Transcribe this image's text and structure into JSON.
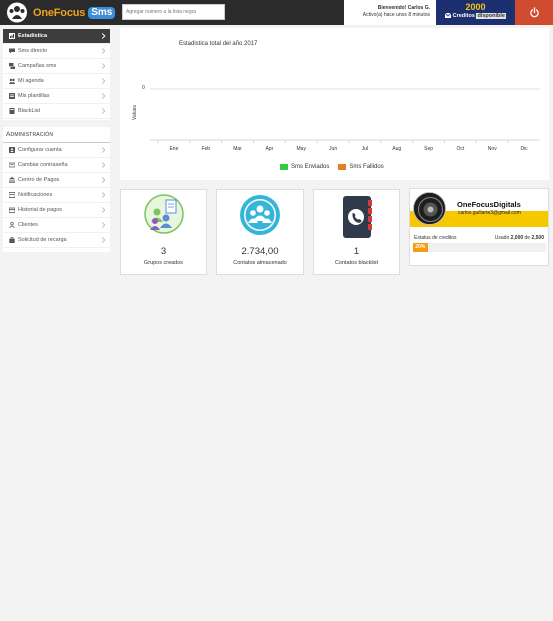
{
  "header": {
    "brand": "OneFocus",
    "brand_sms": "Sms",
    "search_placeholder": "Agregar numero a la lista negra",
    "welcome_line1": "Bienvenido! Carlos G.",
    "welcome_line2": "Activo(a) hace unos 8 minutos",
    "credits_value": "2000",
    "credits_label_1": "Creditos",
    "credits_label_2": "disponible",
    "accent_credits": "#1c2f6e",
    "accent_power": "#d14b2e"
  },
  "sidebar": {
    "items": [
      {
        "label": "Estadística",
        "icon": "chart-icon",
        "active": true
      },
      {
        "label": "Sms directo",
        "icon": "comment-icon"
      },
      {
        "label": "Campañas sms",
        "icon": "comments-icon"
      },
      {
        "label": "Mi agenda",
        "icon": "users-icon"
      },
      {
        "label": "Mis plantillas",
        "icon": "template-icon"
      },
      {
        "label": "BlackList",
        "icon": "book-icon"
      }
    ],
    "admin_title": "Administración",
    "admin_items": [
      {
        "label": "Configurar cuenta",
        "icon": "user-icon"
      },
      {
        "label": "Cambiar contraseña",
        "icon": "key-icon"
      },
      {
        "label": "Centro de Pagos",
        "icon": "bank-icon"
      },
      {
        "label": "Notificaciones",
        "icon": "bell-icon"
      },
      {
        "label": "Historial de pagos",
        "icon": "card-icon"
      },
      {
        "label": "Clientes",
        "icon": "person-icon"
      },
      {
        "label": "Solicitud de recarga",
        "icon": "gift-icon"
      }
    ]
  },
  "chart_data": {
    "type": "line",
    "title": "Estadistica total del año 2017",
    "ylabel": "Values",
    "xlabel": "",
    "categories": [
      "Ene",
      "Feb",
      "Mar",
      "Apr",
      "May",
      "Jun",
      "Jul",
      "Aug",
      "Sep",
      "Oct",
      "Nov",
      "Dic"
    ],
    "y_ticks": [
      "0"
    ],
    "series": [
      {
        "name": "Sms Enviados",
        "color": "#2ecc40",
        "values": [
          0,
          0,
          0,
          0,
          0,
          0,
          0,
          0,
          0,
          0,
          0,
          0
        ]
      },
      {
        "name": "Sms Fallidos",
        "color": "#e67e22",
        "values": [
          0,
          0,
          0,
          0,
          0,
          0,
          0,
          0,
          0,
          0,
          0,
          0
        ]
      }
    ],
    "legend": "bottom"
  },
  "stats": [
    {
      "value": "3",
      "label": "Grupos creados",
      "icon": "groups-icon"
    },
    {
      "value": "2.734,00",
      "label": "Contatos almacenado",
      "icon": "contacts-icon"
    },
    {
      "value": "1",
      "label": "Contatos blacklist",
      "icon": "phonebook-icon"
    }
  ],
  "profile": {
    "name": "OneFocusDigitals",
    "email": "carlos.guillarte3@gmail.com",
    "status_label": "Estatus de creditos",
    "used_prefix": "Usado",
    "used_value": "2,000",
    "used_of": "de",
    "used_total": "2,500",
    "progress_text": "20%",
    "progress_fraction": 0.2
  }
}
